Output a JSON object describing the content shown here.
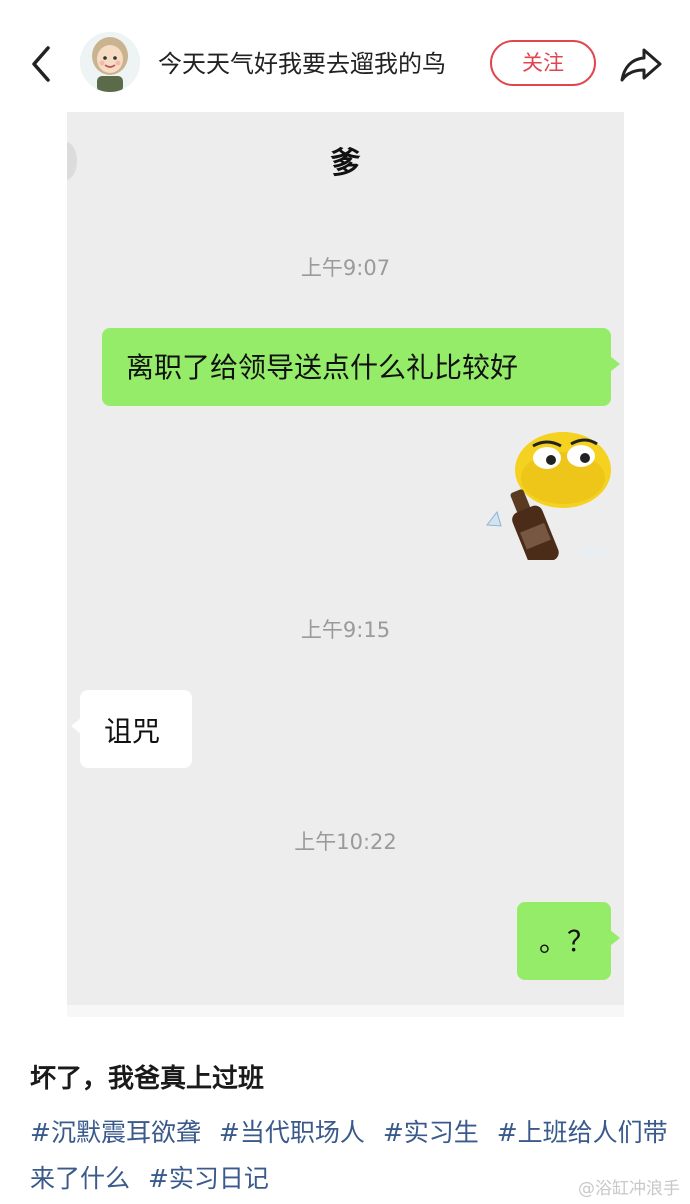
{
  "header": {
    "username": "今天天气好我要去遛我的鸟",
    "follow_label": "关注",
    "accent_color": "#e0464f"
  },
  "chat": {
    "title": "爹",
    "messages": [
      {
        "type": "timestamp",
        "text": "上午9:07"
      },
      {
        "type": "outgoing",
        "text": "离职了给领导送点什么礼比较好"
      },
      {
        "type": "sticker",
        "icon": "smiley-with-bottle-sticker"
      },
      {
        "type": "timestamp",
        "text": "上午9:15"
      },
      {
        "type": "incoming",
        "text": "诅咒"
      },
      {
        "type": "timestamp",
        "text": "上午10:22"
      },
      {
        "type": "outgoing",
        "text": "。？"
      }
    ],
    "bubble_color_outgoing": "#95ec69",
    "bubble_color_incoming": "#ffffff",
    "background_color": "#ededed"
  },
  "post": {
    "title": "坏了，我爸真上过班",
    "tags": [
      "#沉默震耳欲聋",
      "#当代职场人",
      "#实习生",
      "#上班给人们带来了什么",
      "#实习日记"
    ],
    "tag_color": "#3a5a8c"
  },
  "watermark": "@浴缸冲浪手"
}
